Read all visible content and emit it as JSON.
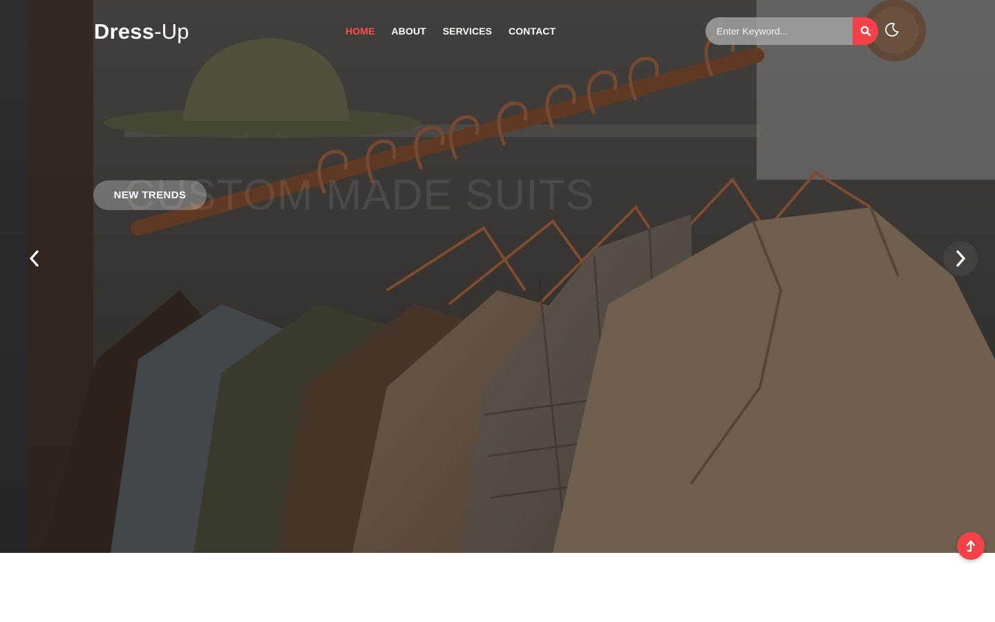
{
  "brand": {
    "logo_bold": "Dress",
    "logo_light": "-Up"
  },
  "nav": {
    "items": [
      {
        "label": "HOME",
        "active": true
      },
      {
        "label": "ABOUT",
        "active": false
      },
      {
        "label": "SERVICES",
        "active": false
      },
      {
        "label": "CONTACT",
        "active": false
      }
    ]
  },
  "search": {
    "placeholder": "Enter Keyword...",
    "icon": "search-icon"
  },
  "theme_toggle": {
    "icon": "moon-icon"
  },
  "slider": {
    "badge": "NEW TRENDS",
    "heading": "CUSTOM MADE SUITS",
    "prev_icon": "chevron-left-icon",
    "next_icon": "chevron-right-icon"
  },
  "scroll_top": {
    "icon": "arrow-up-icon"
  },
  "colors": {
    "accent": "#f5424a",
    "active_nav": "#ff4d4d",
    "text": "#ffffff"
  }
}
